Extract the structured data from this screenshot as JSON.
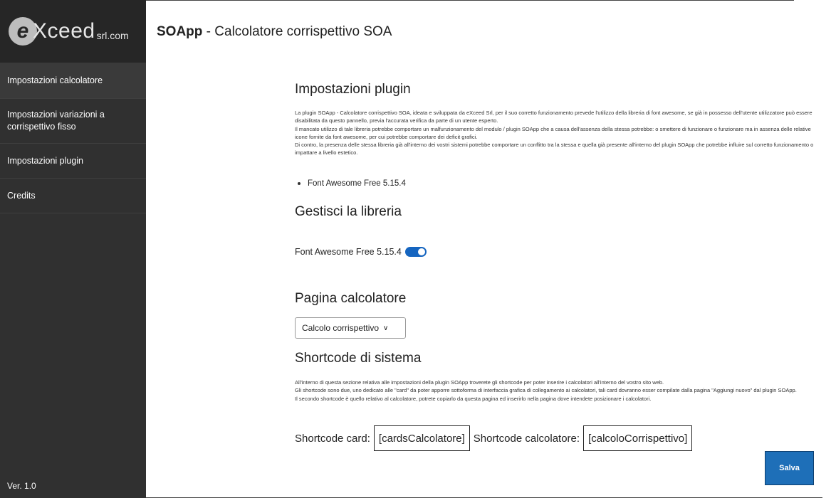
{
  "sidebar": {
    "logo": {
      "ex": "e",
      "ceed": "Xceed",
      "srl": "srl.com"
    },
    "items": [
      {
        "label": "Impostazioni calcolatore"
      },
      {
        "label": "Impostazioni variazioni a corrispettivo fisso"
      },
      {
        "label": "Impostazioni plugin"
      },
      {
        "label": "Credits"
      }
    ],
    "version": "Ver. 1.0"
  },
  "header": {
    "app_name": "SOApp",
    "subtitle": " - Calcolatore corrispettivo SOA"
  },
  "plugin_settings": {
    "title": "Impostazioni plugin",
    "paragraphs": [
      "La plugin SOApp - Calcolatore corrispettivo SOA, ideata e sviluppata da eXceed Srl, per il suo corretto funzionamento prevede l'utilizzo della libreria di font awesome, se già in possesso dell'utente utilizzatore può essere disabilitata da questo pannello, previa l'accurata verifica da parte di un utente esperto.",
      "Il mancato utilizzo di tale libreria potrebbe comportare un malfunzionamento del modulo / plugin SOApp che a causa dell'assenza della stessa potrebbe: o smettere di funzionare o funzionare ma in assenza delle relative icone fornite da font awesome, per cui potrebbe comportare dei deficit grafici.",
      "Di contro, la presenza delle stessa libreria già all'interno dei vostri sistemi potrebbe comportare un conflitto tra la stessa e quella già presente all'interno del plugin SOApp che potrebbe influire sul corretto funzionamento o impattare a livello estetico."
    ],
    "library": "Font Awesome Free 5.15.4"
  },
  "library_manage": {
    "title": "Gestisci la libreria",
    "toggle_label": "Font Awesome Free 5.15.4",
    "toggle_on": true
  },
  "calc_page": {
    "title": "Pagina calcolatore",
    "selected": "Calcolo corrispettivo"
  },
  "shortcode": {
    "title": "Shortcode di sistema",
    "paragraphs": [
      "All'interno di questa sezione relativa alle impostazioni della plugin SOApp troverete gli shortcode per poter inserire i calcolatori all'interno del vostro sito web.",
      "Gli shortcode sono due, uno dedicato alle \"card\" da poter apporre sottoforma di interfaccia grafica di collegamento ai calcolatori, tali card dovranno esser compilate dalla pagina \"Aggiungi nuovo\" dal plugin SOApp.",
      "Il secondo shortcode è quello relativo al calcolatore, potrete copiarlo da questa pagina ed inserirlo nella pagina dove intendete posizionare i calcolatori."
    ],
    "card_label": "Shortcode card:",
    "card_value": "[cardsCalcolatore]",
    "calc_label": "Shortcode calcolatore:",
    "calc_value": "[calcoloCorrispettivo]"
  },
  "actions": {
    "save": "Salva"
  },
  "colors": {
    "sidebar": "#303030",
    "accent": "#1e6fb8",
    "toggle": "#1565c0"
  }
}
